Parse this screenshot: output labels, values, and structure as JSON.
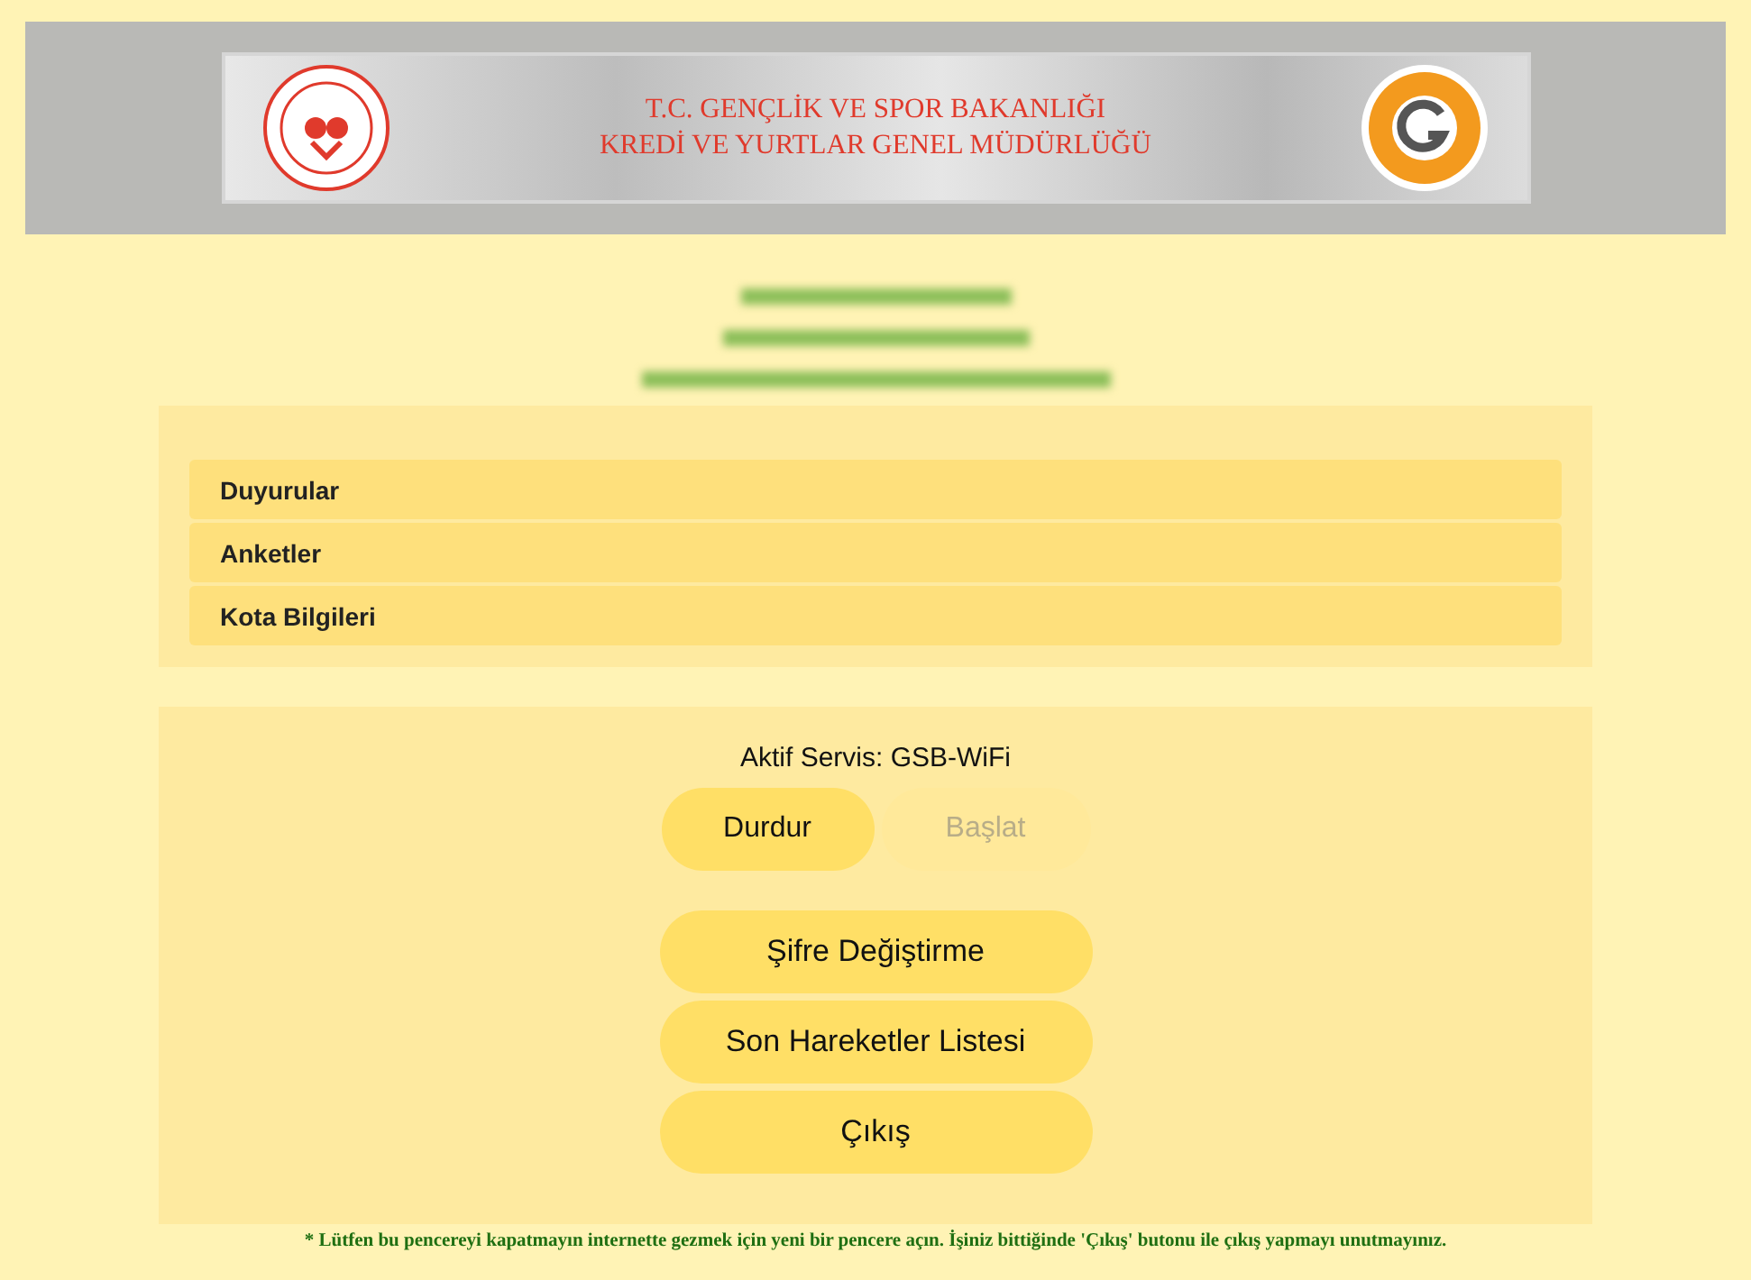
{
  "header": {
    "title_lines": [
      "T.C. GENÇLİK VE SPOR BAKANLIĞI",
      "KREDİ VE YURTLAR GENEL MÜDÜRLÜĞÜ"
    ]
  },
  "menu": [
    {
      "label": "Duyurular"
    },
    {
      "label": "Anketler"
    },
    {
      "label": "Kota Bilgileri"
    }
  ],
  "service": {
    "label": "Aktif Servis: GSB-WiFi",
    "controls": [
      {
        "label": "Durdur",
        "disabled": false
      },
      {
        "label": "Başlat",
        "disabled": true
      }
    ]
  },
  "actions": [
    {
      "label": "Şifre Değiştirme"
    },
    {
      "label": "Son Hareketler Listesi"
    },
    {
      "label": "Çıkış"
    }
  ],
  "footer_note": "* Lütfen bu pencereyi kapatmayın internette gezmek için yeni bir pencere açın. İşiniz bittiğinde 'Çıkış' butonu ile çıkış yapmayı unutmayınız."
}
